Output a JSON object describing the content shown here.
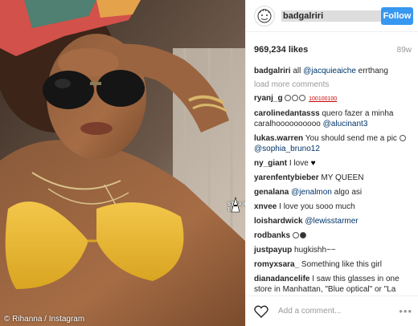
{
  "photo": {
    "credit": "© Rihanna / Instagram",
    "watermark": "STRAIGHT FROM THE"
  },
  "header": {
    "username": "badgalriri",
    "follow_label": "Follow"
  },
  "stats": {
    "likes": "969,234 likes",
    "age": "89w"
  },
  "caption": {
    "user": "badgalriri",
    "text": " all ",
    "mention": "@jacquieaiche",
    "after": " errthang"
  },
  "load_more": "load more comments",
  "comments": [
    {
      "user": "ryanj_g",
      "text": "",
      "mention": "",
      "emoji": [
        "smiley",
        "smiley",
        "smiley",
        "100",
        "100",
        "100"
      ]
    },
    {
      "user": "carolinedantasss",
      "text": " quero fazer a minha caralhoooooooooo ",
      "mention": "@alucinant3"
    },
    {
      "user": "lukas.warren",
      "text": " You should send me a pic ",
      "mention": "@sophia_bruno12",
      "emoji": [
        "smiley"
      ]
    },
    {
      "user": "ny_giant",
      "text": " I love ",
      "mention": "",
      "emoji": [
        "heart"
      ]
    },
    {
      "user": "yarenfentybieber",
      "text": " MY QUEEN",
      "mention": ""
    },
    {
      "user": "genalana",
      "text": " ",
      "mention": "@jenalmon",
      "after": " algo asi"
    },
    {
      "user": "xnvee",
      "text": " I love you sooo much",
      "mention": ""
    },
    {
      "user": "loishardwick",
      "text": " ",
      "mention": "@lewisstarmer"
    },
    {
      "user": "rodbanks",
      "text": "",
      "mention": "",
      "emoji": [
        "smiley",
        "face"
      ]
    },
    {
      "user": "justpayup",
      "text": " hugkishh~~",
      "mention": ""
    },
    {
      "user": "romyxsara_",
      "text": " Something like this girl",
      "mention": ""
    },
    {
      "user": "dianadancelife",
      "text": " I saw this glasses in one store in Manhattan, \"Blue optical\" or \"La",
      "mention": ""
    }
  ],
  "footer": {
    "add_comment_placeholder": "Add a comment...",
    "more_label": "•••"
  },
  "colors": {
    "follow_button": "#3897f0",
    "mention": "#003569",
    "muted": "#999999"
  },
  "icons": [
    "avatar-icon",
    "heart-icon",
    "more-options-icon"
  ]
}
